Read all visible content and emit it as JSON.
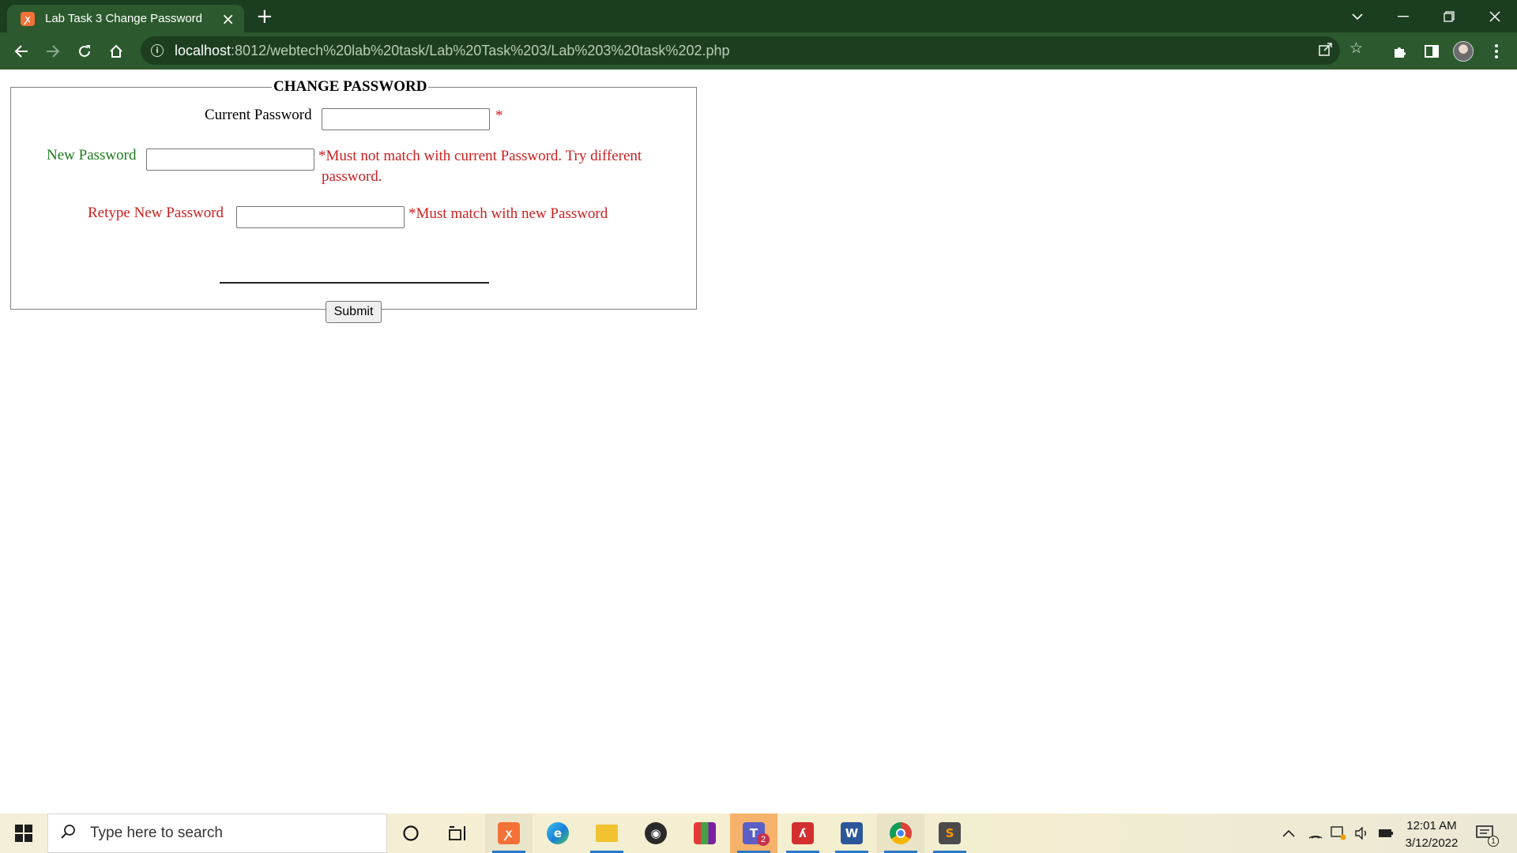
{
  "browser": {
    "tab_title": "Lab Task 3 Change Password",
    "tab_favicon_glyph": "✕",
    "new_tab_glyph": "+",
    "url_host": "localhost",
    "url_rest": ":8012/webtech%20lab%20task/Lab%20Task%203/Lab%203%20task%202.php",
    "theme_color": "#2c5a2e"
  },
  "form": {
    "legend": "CHANGE PASSWORD",
    "current_password_label": "Current Password",
    "current_password_marker": "*",
    "new_password_label": "New Password",
    "new_password_error_line1": "*Must not match with current Password. Try different",
    "new_password_error_line2": "password.",
    "retype_password_label": "Retype New Password",
    "retype_password_error": "*Must match with new Password",
    "submit_label": "Submit",
    "colors": {
      "label_black": "#000000",
      "label_green": "#1e7a1e",
      "label_red": "#cc1f1f"
    }
  },
  "taskbar": {
    "search_placeholder": "Type here to search",
    "teams_badge": "2",
    "time": "12:01 AM",
    "date": "3/12/2022",
    "notification_count": "1"
  }
}
